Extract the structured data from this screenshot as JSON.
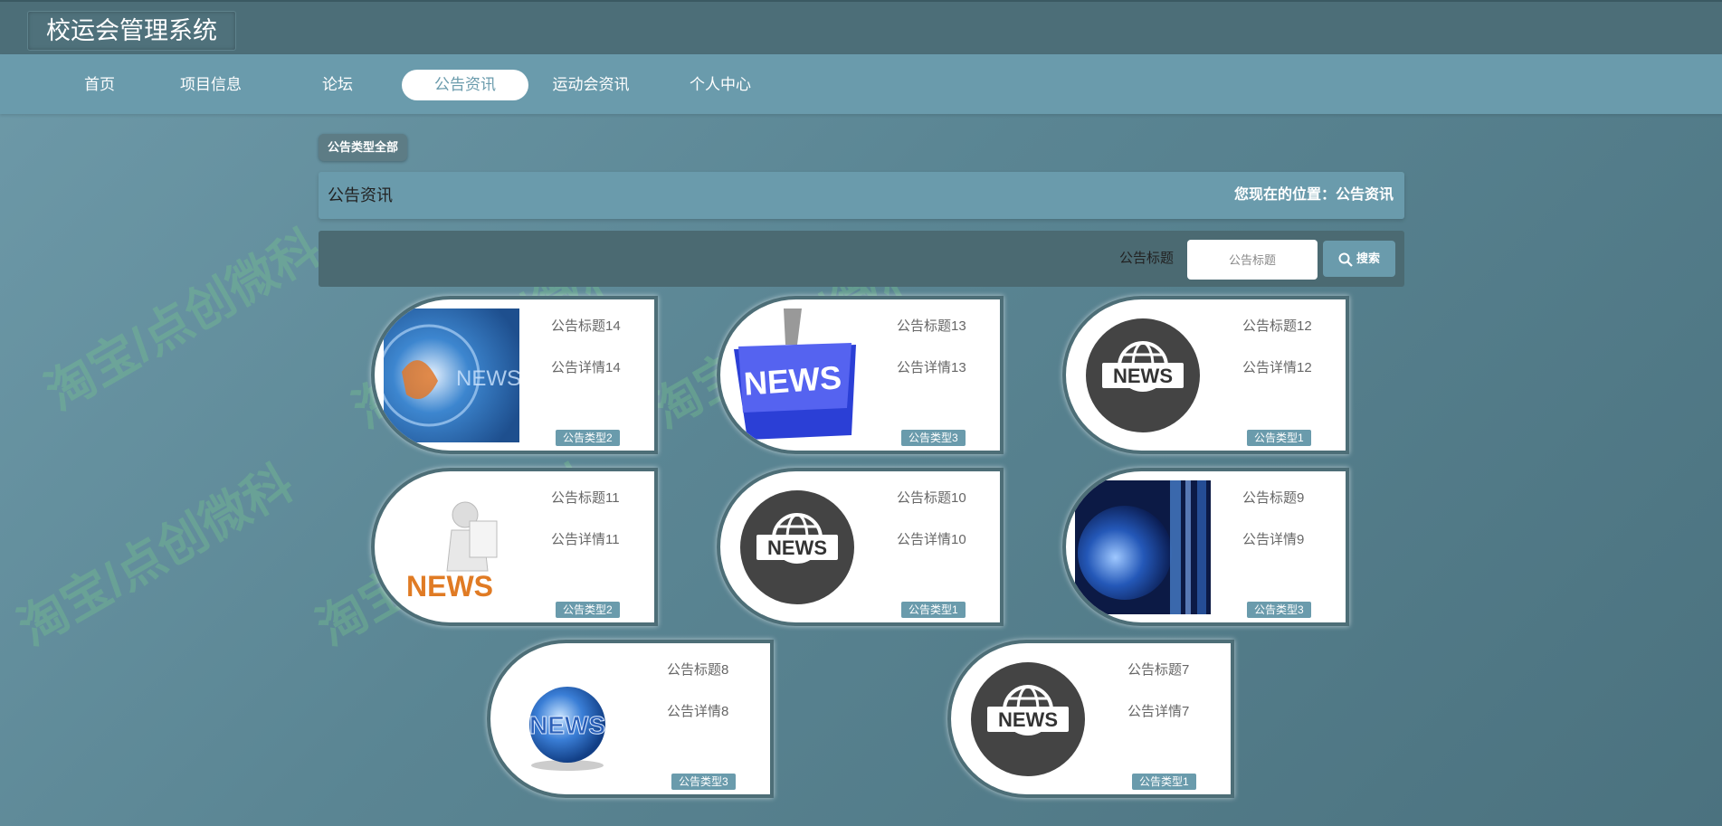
{
  "app": {
    "title": "校运会管理系统"
  },
  "nav": {
    "items": [
      "首页",
      "项目信息",
      "论坛",
      "公告资讯",
      "运动会资讯",
      "个人中心"
    ],
    "active_index": 3
  },
  "filter": {
    "chip": "公告类型全部"
  },
  "breadcrumb": {
    "title": "公告资讯",
    "location": "您现在的位置：公告资讯"
  },
  "search": {
    "label": "公告标题",
    "placeholder": "公告标题",
    "button": "搜索"
  },
  "cards": [
    {
      "title": "公告标题14",
      "desc": "公告详情14",
      "type": "公告类型2",
      "image": "news-blue-photo"
    },
    {
      "title": "公告标题13",
      "desc": "公告详情13",
      "type": "公告类型3",
      "image": "news-keyboard-key"
    },
    {
      "title": "公告标题12",
      "desc": "公告详情12",
      "type": "公告类型1",
      "image": "news-globe-badge"
    },
    {
      "title": "公告标题11",
      "desc": "公告详情11",
      "type": "公告类型2",
      "image": "news-3d-figure"
    },
    {
      "title": "公告标题10",
      "desc": "公告详情10",
      "type": "公告类型1",
      "image": "news-globe-badge"
    },
    {
      "title": "公告标题9",
      "desc": "公告详情9",
      "type": "公告类型3",
      "image": "news-earth-photo"
    },
    {
      "title": "公告标题8",
      "desc": "公告详情8",
      "type": "公告类型3",
      "image": "news-3d-globe"
    },
    {
      "title": "公告标题7",
      "desc": "公告详情7",
      "type": "公告类型1",
      "image": "news-globe-badge"
    }
  ],
  "watermark": "淘宝/点创微科",
  "colors": {
    "header": "#4c6e78",
    "nav": "#6a9bac",
    "accent": "#6a9bac",
    "card_border": "#4d6e77"
  }
}
